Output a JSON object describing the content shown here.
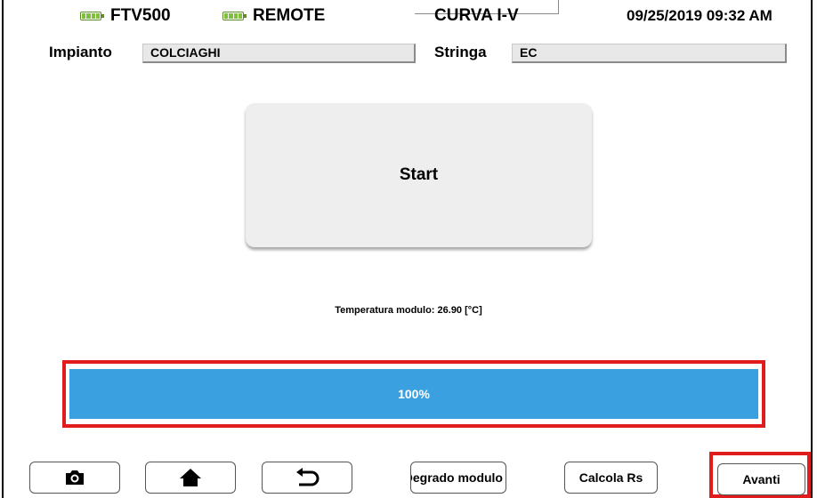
{
  "header": {
    "device": "FTV500",
    "mode": "REMOTE",
    "function": "CURVA I-V",
    "datetime": "09/25/2019 09:32 AM",
    "battery_icon": "battery-icon"
  },
  "fields": {
    "impianto_label": "Impianto",
    "impianto_value": "COLCIAGHI",
    "stringa_label": "Stringa",
    "stringa_value": "EC"
  },
  "main": {
    "start_label": "Start",
    "temperature_text": "Temperatura modulo: 26.90 [°C]"
  },
  "progress": {
    "value": 1.0,
    "text": "100%",
    "fill_color": "#3ba0e0"
  },
  "toolbar": {
    "camera_icon": "camera-icon",
    "home_icon": "home-icon",
    "back_icon": "back-arrow-icon",
    "degrado_label": "Degrado modulo",
    "calcola_label": "Calcola Rs",
    "avanti_label": "Avanti"
  },
  "colors": {
    "highlight": "#e01c1c",
    "battery": "#7fbf3a"
  }
}
